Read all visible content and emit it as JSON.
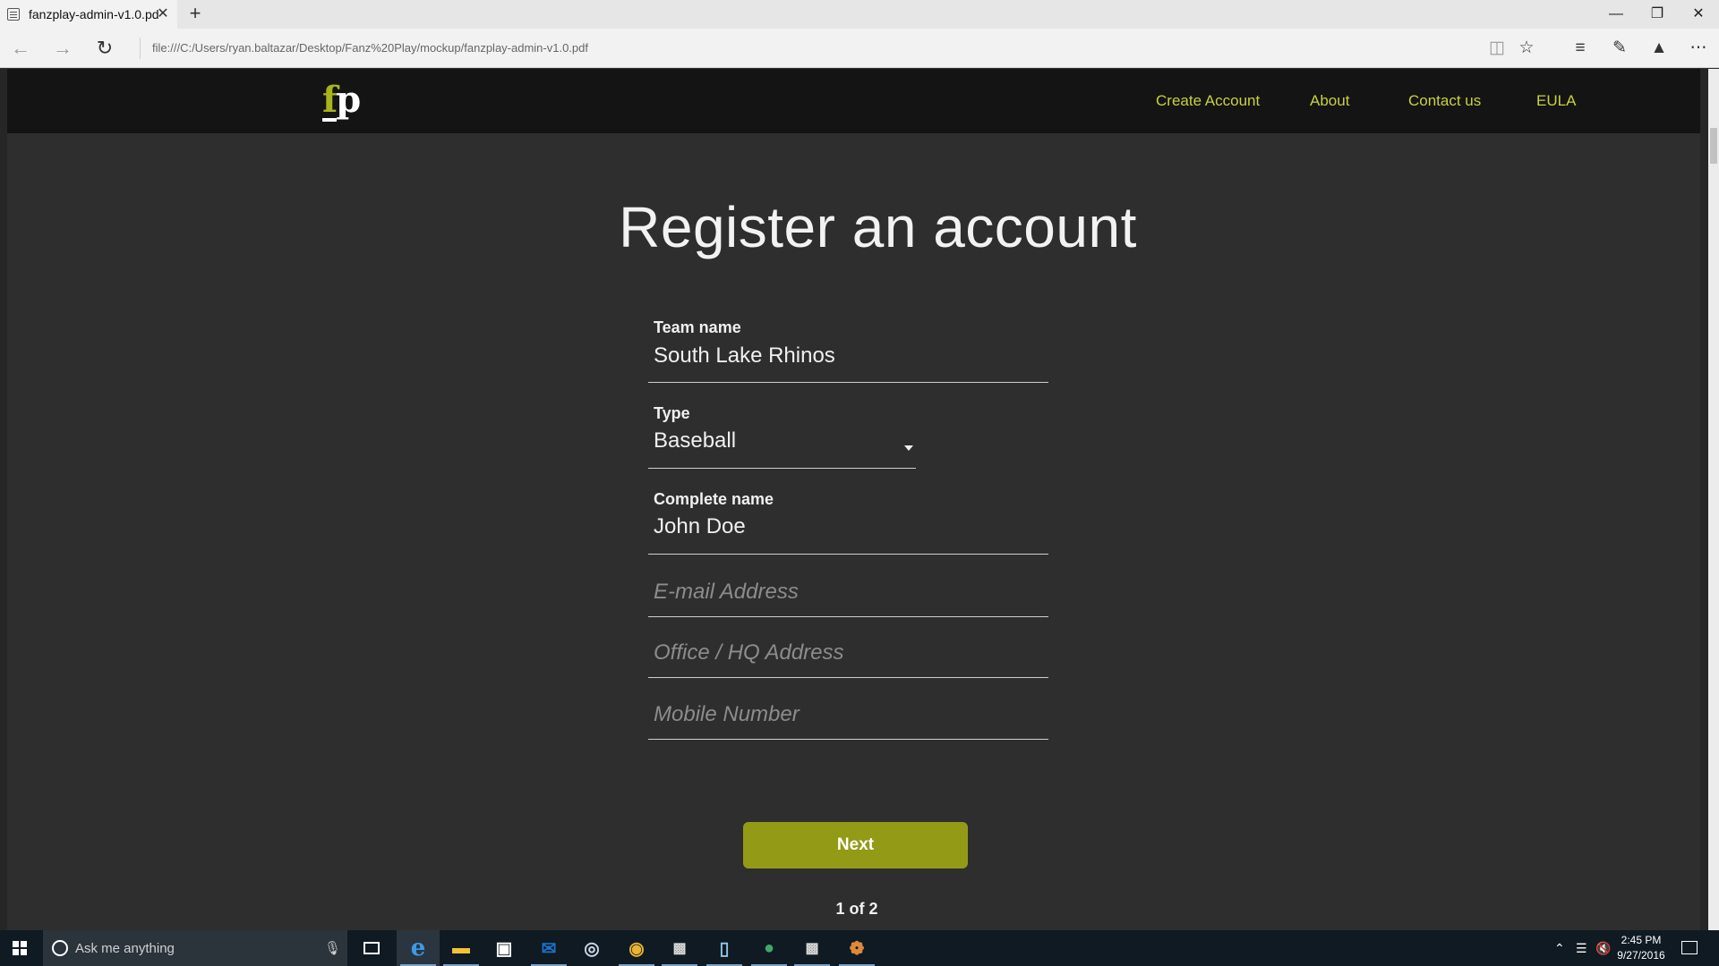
{
  "browser": {
    "tab_title": "fanzplay-admin-v1.0.pd",
    "tab_close": "✕",
    "new_tab": "+",
    "url": "file:///C:/Users/ryan.baltazar/Desktop/Fanz%20Play/mockup/fanzplay-admin-v1.0.pdf",
    "icons": [
      "back-icon",
      "forward-icon",
      "refresh-icon",
      "reading-view-icon",
      "favorite-icon",
      "hub-icon",
      "web-note-icon",
      "share-icon",
      "more-icon"
    ]
  },
  "site": {
    "logo_f": "f",
    "logo_p": "p",
    "nav": [
      "Create Account",
      "About",
      "Contact us",
      "EULA"
    ],
    "accent": "#c8d23c"
  },
  "form": {
    "title": "Register an account",
    "team_name": {
      "label": "Team name",
      "value": "South Lake Rhinos"
    },
    "type": {
      "label": "Type",
      "value": "Baseball"
    },
    "complete_name": {
      "label": "Complete name",
      "value": "John Doe"
    },
    "email": {
      "placeholder": "E-mail Address"
    },
    "address": {
      "placeholder": "Office / HQ Address"
    },
    "mobile": {
      "placeholder": "Mobile Number"
    },
    "next_label": "Next",
    "button_color": "#939a16",
    "pager": "1 of 2"
  },
  "taskbar": {
    "search_placeholder": "Ask me anything",
    "time": "2:45 PM",
    "date": "9/27/2016"
  }
}
